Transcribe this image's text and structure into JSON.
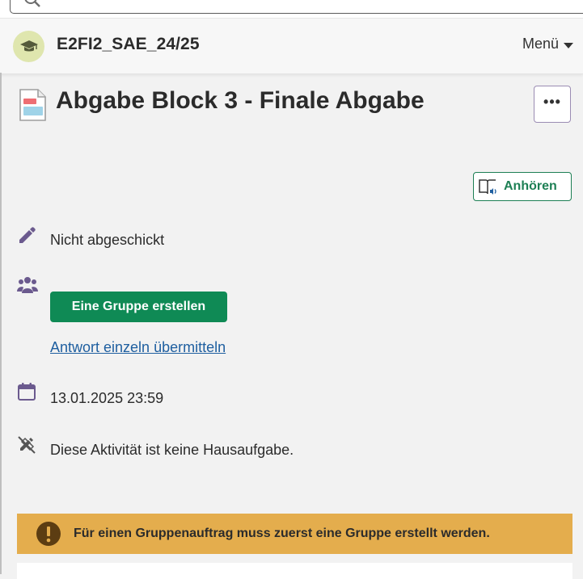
{
  "course": {
    "title": "E2FI2_SAE_24/25"
  },
  "menu": {
    "label": "Menü"
  },
  "activity": {
    "title": "Abgabe Block 3 - Finale Abgabe"
  },
  "more_button": {
    "label": "•••"
  },
  "listen_button": {
    "label": "Anhören"
  },
  "status": {
    "submission": "Nicht abgeschickt"
  },
  "group": {
    "create_label": "Eine Gruppe erstellen",
    "individual_link": "Antwort einzeln übermitteln"
  },
  "due_date": "13.01.2025 23:59",
  "homework_note": "Diese Aktivität ist keine Hausaufgabe.",
  "alert": {
    "text": "Für einen Gruppenauftrag muss zuerst eine Gruppe erstellt werden."
  },
  "colors": {
    "primary_green": "#0f8a55",
    "link_blue": "#1f5fa0",
    "icon_purple": "#6b5a8e",
    "warning": "#e4ad4d"
  },
  "icons": [
    "search-icon",
    "graduation-cap-icon",
    "chevron-down-icon",
    "assignment-icon",
    "more-icon",
    "listen-icon",
    "pencil-icon",
    "users-icon",
    "calendar-icon",
    "no-homework-icon",
    "warning-icon"
  ]
}
